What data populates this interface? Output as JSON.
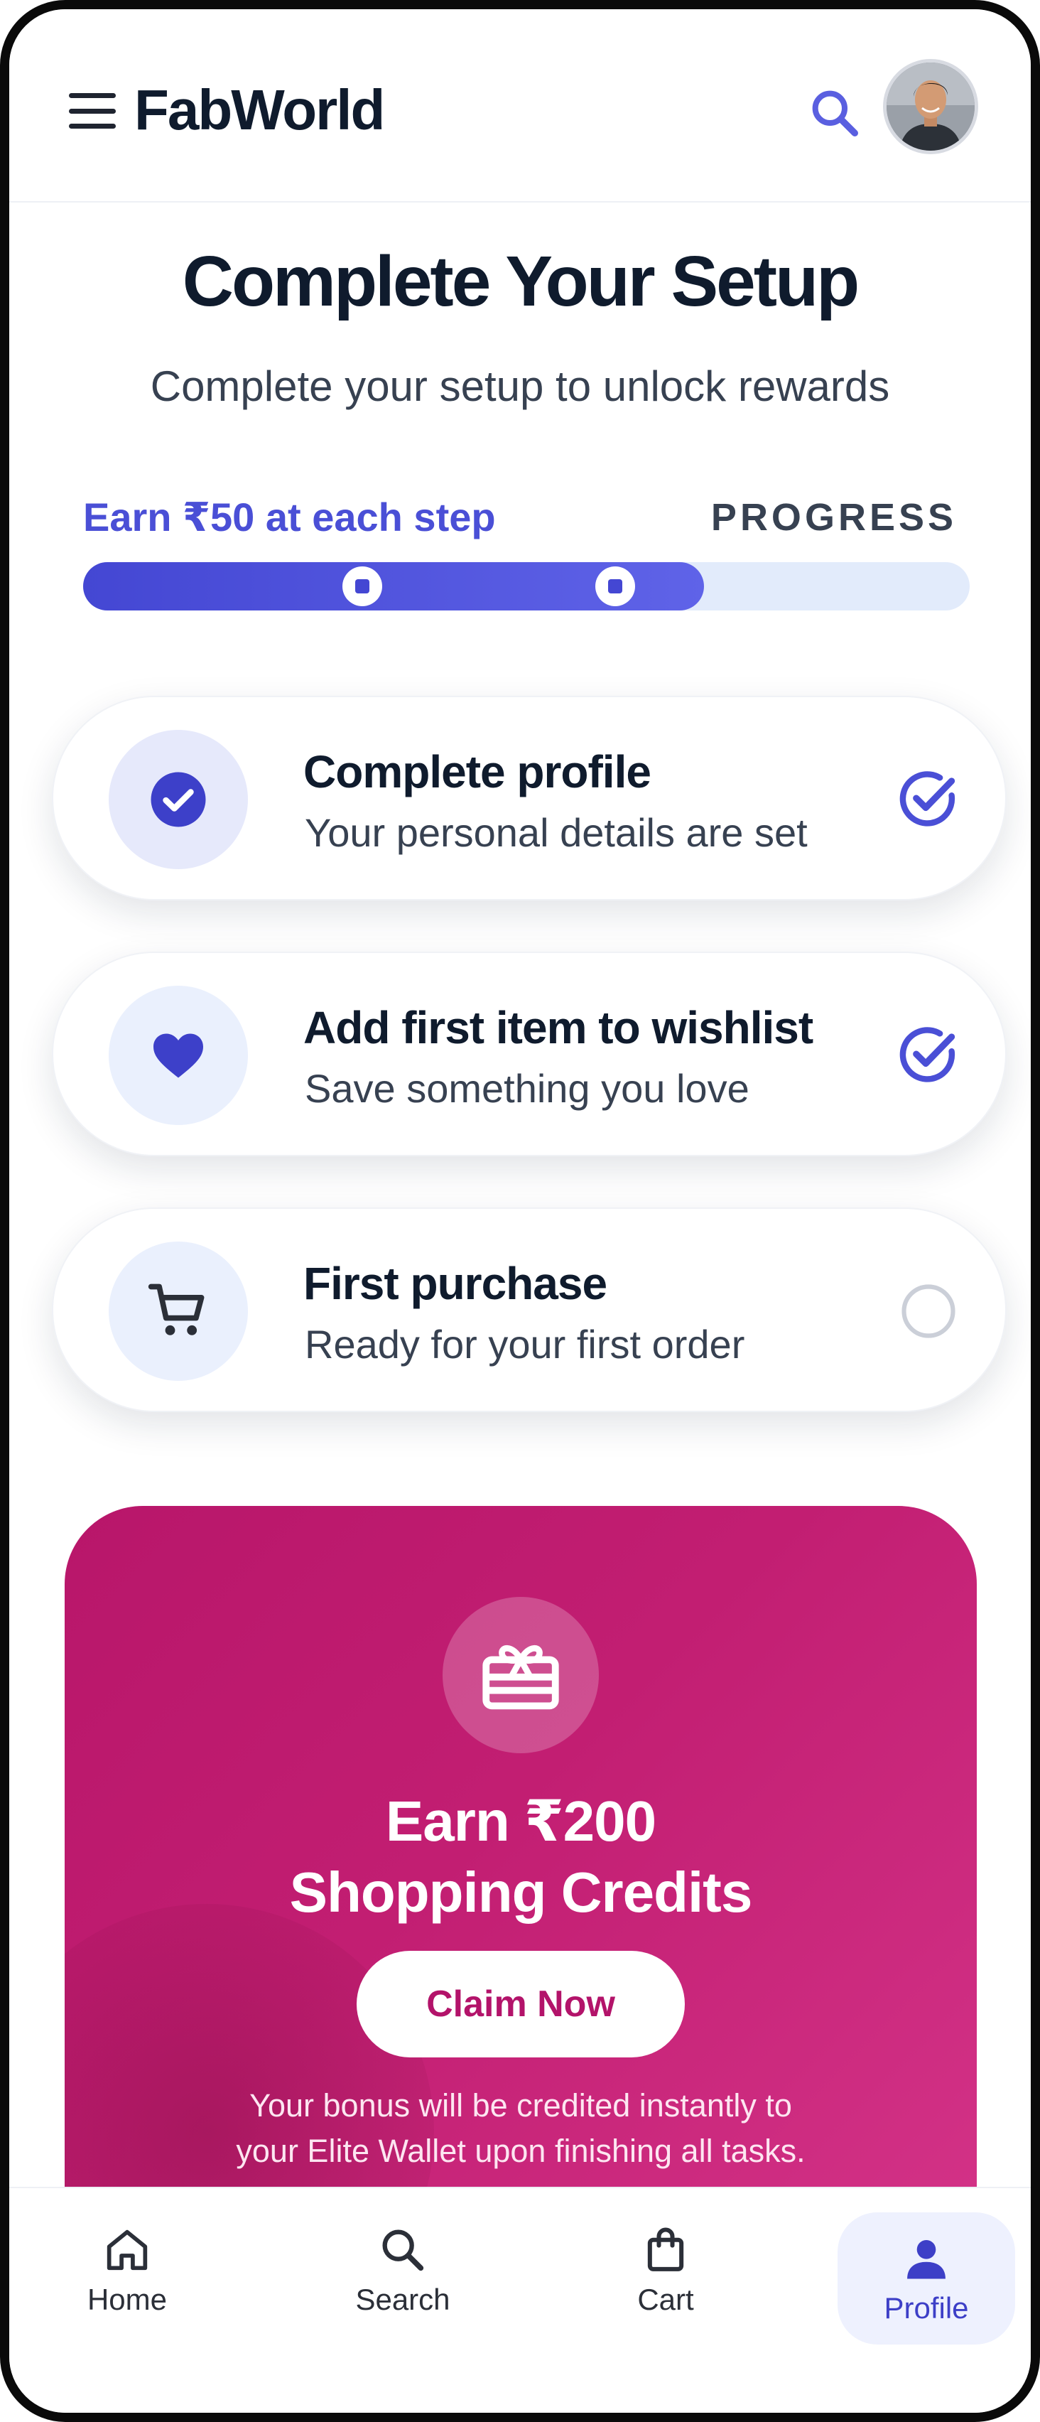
{
  "app": {
    "brand": "FabWorld"
  },
  "header": {
    "menu_icon": "menu-icon",
    "search_icon": "search-icon",
    "avatar_icon": "user-avatar"
  },
  "page": {
    "title": "Complete Your Setup",
    "subtitle": "Complete your setup to unlock rewards"
  },
  "progress": {
    "earn_label": "Earn ₹50 at each step",
    "label": "PROGRESS",
    "fraction": 0.7,
    "markers": [
      0.315,
      0.6
    ]
  },
  "tasks": [
    {
      "title": "Complete profile",
      "subtitle": "Your personal details are set",
      "icon": "check-circle-icon",
      "status": "done"
    },
    {
      "title": "Add first item to wishlist",
      "subtitle": "Save something you love",
      "icon": "heart-icon",
      "status": "done"
    },
    {
      "title": "First purchase",
      "subtitle": "Ready for your first order",
      "icon": "cart-icon",
      "status": "pending"
    }
  ],
  "promo": {
    "title_line1": "Earn ₹200",
    "title_line2": "Shopping Credits",
    "button": "Claim Now",
    "note_line1": "Your bonus will be credited instantly to",
    "note_line2": "your Elite Wallet upon finishing all tasks.",
    "icon": "gift-card-icon"
  },
  "nav": [
    {
      "label": "Home",
      "icon": "home-icon",
      "active": false
    },
    {
      "label": "Search",
      "icon": "search-icon",
      "active": false
    },
    {
      "label": "Cart",
      "icon": "shopping-bag-icon",
      "active": false
    },
    {
      "label": "Profile",
      "icon": "person-icon",
      "active": true
    }
  ],
  "colors": {
    "accent": "#4a4fd6",
    "promo": "#c21e72",
    "text": "#0f1b2d"
  }
}
